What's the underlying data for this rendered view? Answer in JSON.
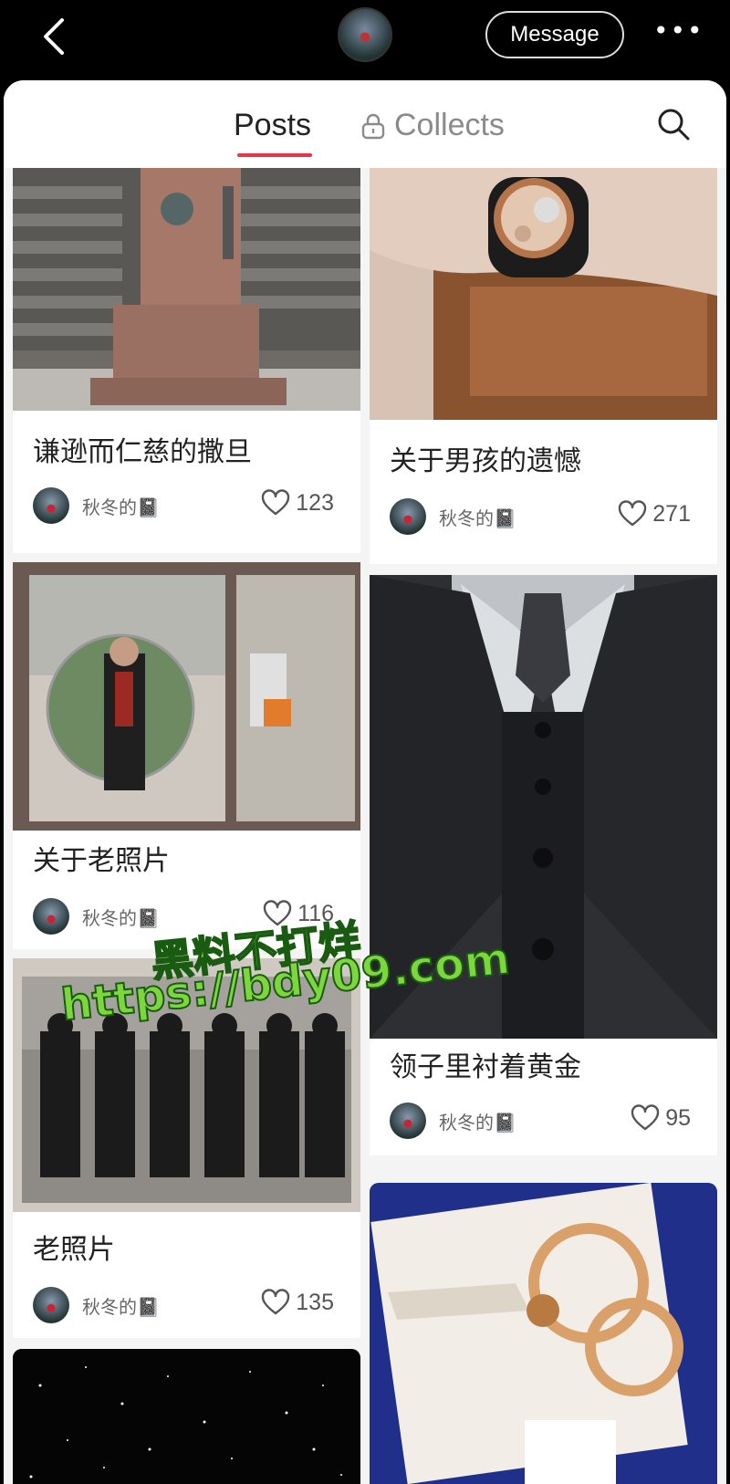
{
  "header": {
    "message_label": "Message",
    "more_label": "•••"
  },
  "tabs": {
    "posts": "Posts",
    "collects": "Collects"
  },
  "posts": [
    {
      "title": "谦逊而仁慈的撒旦",
      "author": "秋冬的📓",
      "likes": "123"
    },
    {
      "title": "关于男孩的遗憾",
      "author": "秋冬的📓",
      "likes": "271"
    },
    {
      "title": "关于老照片",
      "author": "秋冬的📓",
      "likes": "116"
    },
    {
      "title": "领子里衬着黄金",
      "author": "秋冬的📓",
      "likes": "95"
    },
    {
      "title": "老照片",
      "author": "秋冬的📓",
      "likes": "135"
    }
  ],
  "watermark": {
    "line1": "黑料不打烊",
    "line2": "https://bdy09.com"
  },
  "colors": {
    "accent": "#e8344b",
    "watermark": "#7dd63d"
  }
}
